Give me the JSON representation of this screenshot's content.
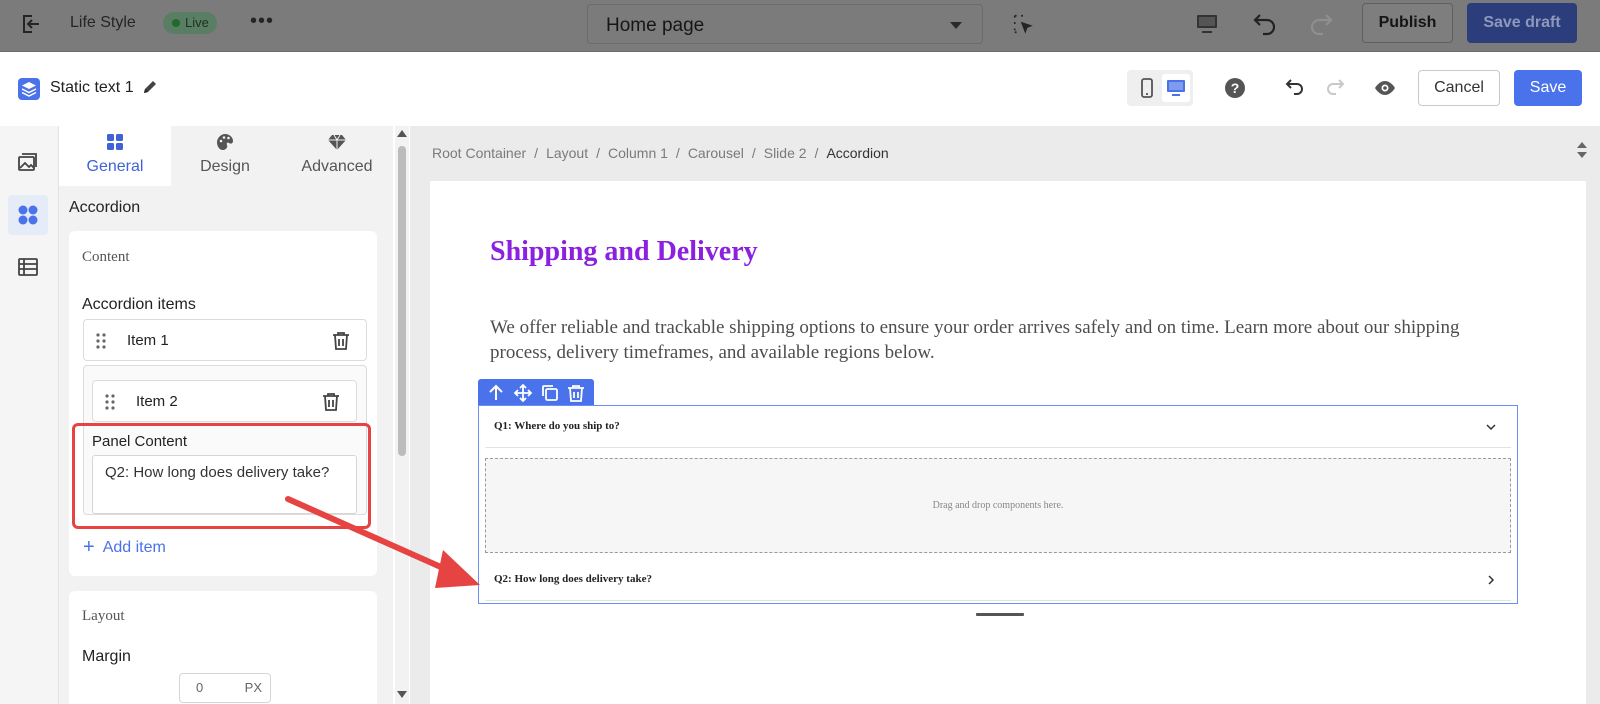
{
  "topbar": {
    "site_name": "Life Style",
    "live_badge": "Live",
    "more_label": "•••",
    "page_select": "Home page",
    "publish_label": "Publish",
    "save_draft_label": "Save draft"
  },
  "editor_header": {
    "component_name": "Static text 1",
    "cancel_label": "Cancel",
    "save_label": "Save"
  },
  "tabs": [
    {
      "label": "General",
      "icon": "grid-icon",
      "active": true
    },
    {
      "label": "Design",
      "icon": "brush-icon",
      "active": false
    },
    {
      "label": "Advanced",
      "icon": "diamond-icon",
      "active": false
    }
  ],
  "panel": {
    "heading": "Accordion",
    "content_section": {
      "title": "Content",
      "accordion_items_label": "Accordion items",
      "items": [
        {
          "label": "Item 1"
        },
        {
          "label": "Item 2"
        }
      ],
      "panel_content_label": "Panel Content",
      "panel_content_value": "Q2: How long does delivery take?",
      "add_item_label": "Add item"
    },
    "layout_section": {
      "title": "Layout",
      "margin_label": "Margin",
      "margin_value": "0",
      "margin_unit": "PX"
    }
  },
  "breadcrumb": [
    "Root Container",
    "Layout",
    "Column 1",
    "Carousel",
    "Slide 2",
    "Accordion"
  ],
  "breadcrumb_sep": "/",
  "canvas": {
    "title": "Shipping and Delivery",
    "intro": "We offer reliable and trackable shipping options to ensure your order arrives safely and on time. Learn more about our shipping process, delivery timeframes, and available regions below.",
    "accordion": [
      {
        "question": "Q1: Where do you ship to?",
        "expanded": true
      },
      {
        "question": "Q2: How long does delivery take?",
        "expanded": false
      }
    ],
    "dropzone_text": "Drag and drop components here."
  },
  "colors": {
    "accent": "#4a72ea",
    "title_purple": "#8b20e0",
    "annotation_red": "#e64343"
  }
}
